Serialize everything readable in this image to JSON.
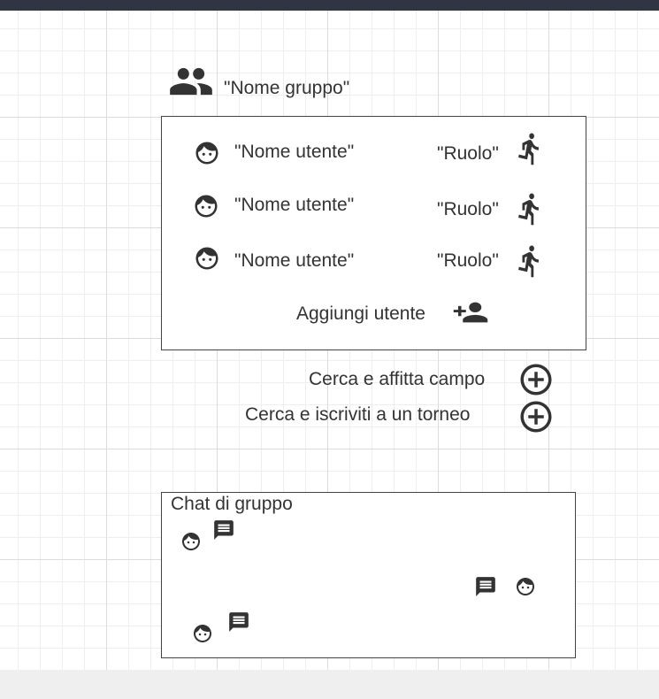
{
  "group": {
    "name": "\"Nome gruppo\"",
    "icon": "group-icon"
  },
  "members": [
    {
      "name": "\"Nome utente\"",
      "role": "\"Ruolo\"",
      "avatar_icon": "face-icon",
      "role_icon": "running-icon"
    },
    {
      "name": "\"Nome utente\"",
      "role": "\"Ruolo\"",
      "avatar_icon": "face-icon",
      "role_icon": "running-icon"
    },
    {
      "name": "\"Nome utente\"",
      "role": "\"Ruolo\"",
      "avatar_icon": "face-icon",
      "role_icon": "running-icon"
    }
  ],
  "add_user": {
    "label": "Aggiungi utente",
    "icon": "add-person-icon"
  },
  "actions": [
    {
      "label": "Cerca e affitta campo",
      "icon": "add-circle-icon"
    },
    {
      "label": "Cerca e iscriviti a un torneo",
      "icon": "add-circle-icon"
    }
  ],
  "chat": {
    "title": "Chat di gruppo",
    "messages": [
      {
        "side": "left",
        "avatar_icon": "face-icon",
        "message_icon": "message-icon"
      },
      {
        "side": "right",
        "avatar_icon": "face-icon",
        "message_icon": "message-icon"
      },
      {
        "side": "left",
        "avatar_icon": "face-icon",
        "message_icon": "message-icon"
      }
    ]
  },
  "colors": {
    "icon": "#333333",
    "text": "#333333",
    "top_bar": "#2f3542",
    "bottom_area": "#efefef",
    "grid_major": "#dcdcdc",
    "grid_minor": "#eeeeee"
  }
}
